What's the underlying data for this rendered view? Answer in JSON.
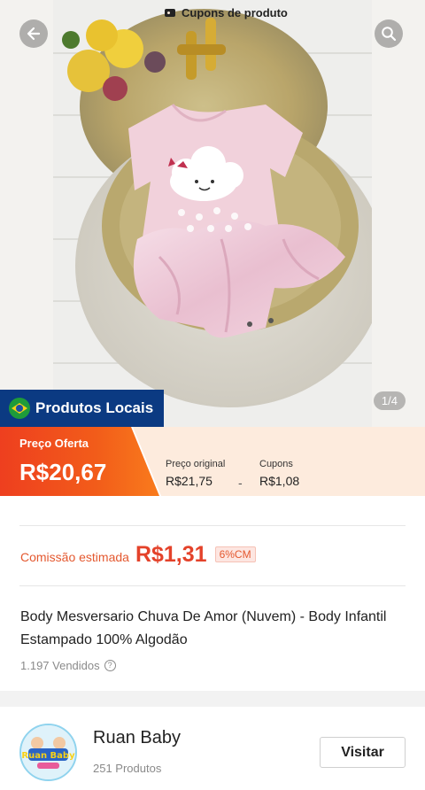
{
  "hero": {
    "counter": "1/4",
    "local_badge": "Produtos Locais",
    "icons": {
      "back": "back-arrow-icon",
      "search": "search-icon",
      "flag": "brazil-flag-icon"
    }
  },
  "price": {
    "offer_label": "Preço Oferta",
    "offer_value": "R$20,67",
    "coupons_title": "Cupons de produto",
    "original_label": "Preço original",
    "original_value": "R$21,75",
    "separator": "-",
    "coupons_label": "Cupons",
    "coupons_value": "R$1,08"
  },
  "commission": {
    "label": "Comissão estimada",
    "value": "R$1,31",
    "rate": "6%CM"
  },
  "product": {
    "title": "Body Mesversario Chuva De Amor (Nuvem) - Body Infantil Estampado 100% Algodão",
    "sold": "1.197 Vendidos"
  },
  "shop": {
    "logo_text": "Ruan Baby",
    "name": "Ruan Baby",
    "product_count": "251 Produtos",
    "visit_label": "Visitar"
  },
  "colors": {
    "offer_gradient_start": "#ee3f1f",
    "offer_gradient_end": "#f97b1c",
    "badge_blue": "#0b3a82",
    "commission_red": "#e4422a",
    "coupon_bg": "#fdebdd"
  }
}
